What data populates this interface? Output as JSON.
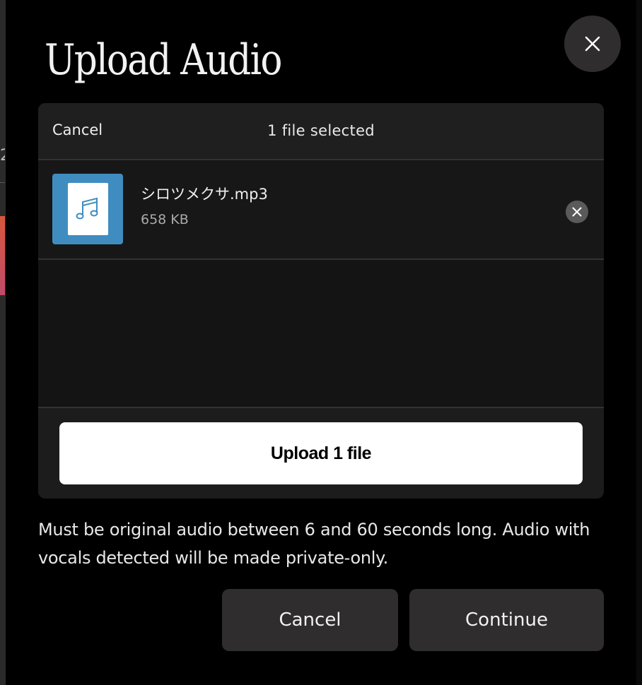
{
  "dialog": {
    "title": "Upload Audio",
    "close_icon": "close-icon"
  },
  "uploader": {
    "cancel_label": "Cancel",
    "selection_status": "1 file selected",
    "files": [
      {
        "name": "シロツメクサ.mp3",
        "size": "658 KB",
        "icon": "music-note-icon",
        "remove_icon": "remove-icon"
      }
    ],
    "upload_label": "Upload 1 file"
  },
  "note": "Must be original audio between 6 and 60 seconds long. Audio with vocals detected will be made private-only.",
  "actions": {
    "cancel_label": "Cancel",
    "continue_label": "Continue"
  },
  "colors": {
    "thumb_background": "#3f8dc0",
    "panel_background": "#1c1c1c",
    "button_dark": "#2f2d2d"
  }
}
